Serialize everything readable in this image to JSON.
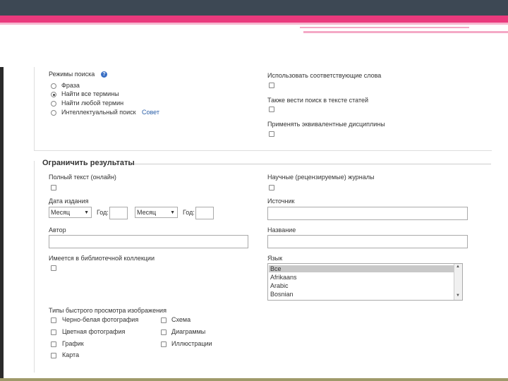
{
  "search_modes": {
    "title": "Режимы поиска",
    "help": "?",
    "options": [
      "Фраза",
      "Найти все термины",
      "Найти любой термин",
      "Интеллектуальный поиск"
    ],
    "selected_index": 1,
    "tip_link": "Совет"
  },
  "right_options": [
    "Использовать соответствующие слова",
    "Также вести поиск в тексте статей",
    "Применять эквивалентные дисциплины"
  ],
  "limit": {
    "title": "Ограничить результаты",
    "full_text": "Полный текст (онлайн)",
    "peer_reviewed": "Научные (рецензируемые) журналы",
    "pub_date": "Дата издания",
    "month_select": "Месяц",
    "year_label": "Год:",
    "source": "Источник",
    "author": "Автор",
    "title_field": "Название",
    "in_library": "Имеется в библиотечной коллекции",
    "language": "Язык",
    "languages": [
      "Все",
      "Afrikaans",
      "Arabic",
      "Bosnian"
    ],
    "language_selected_index": 0
  },
  "image_types": {
    "title": "Типы быстрого просмотра изображения",
    "col1": [
      "Черно-белая фотография",
      "Цветная фотография",
      "График",
      "Карта"
    ],
    "col2": [
      "Схема",
      "Диаграммы",
      "Иллюстрации"
    ]
  }
}
